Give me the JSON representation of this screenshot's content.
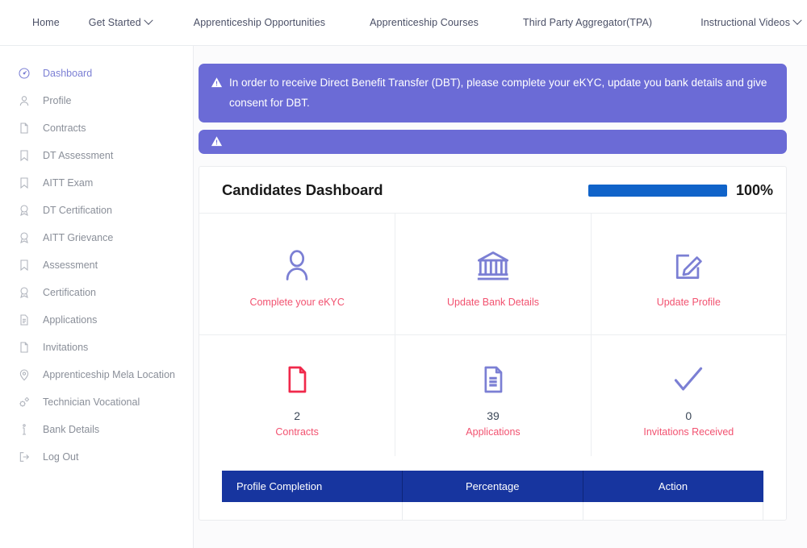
{
  "topnav": {
    "items": [
      {
        "label": "Home",
        "has_chevron": false
      },
      {
        "label": "Get Started",
        "has_chevron": true
      },
      {
        "label": "Apprenticeship Opportunities",
        "has_chevron": false
      },
      {
        "label": "Apprenticeship Courses",
        "has_chevron": false
      },
      {
        "label": "Third Party Aggregator(TPA)",
        "has_chevron": false
      },
      {
        "label": "Instructional Videos",
        "has_chevron": true
      }
    ]
  },
  "sidebar": {
    "items": [
      {
        "label": "Dashboard",
        "icon": "dashboard-gauge-icon",
        "active": true
      },
      {
        "label": "Profile",
        "icon": "user-icon",
        "active": false
      },
      {
        "label": "Contracts",
        "icon": "document-icon",
        "active": false
      },
      {
        "label": "DT Assessment",
        "icon": "bookmark-icon",
        "active": false
      },
      {
        "label": "AITT Exam",
        "icon": "bookmark-icon",
        "active": false
      },
      {
        "label": "DT Certification",
        "icon": "award-icon",
        "active": false
      },
      {
        "label": "AITT Grievance",
        "icon": "award-icon",
        "active": false
      },
      {
        "label": "Assessment",
        "icon": "bookmark-icon",
        "active": false
      },
      {
        "label": "Certification",
        "icon": "award-icon",
        "active": false
      },
      {
        "label": "Applications",
        "icon": "file-lines-icon",
        "active": false
      },
      {
        "label": "Invitations",
        "icon": "document-icon",
        "active": false
      },
      {
        "label": "Apprenticeship Mela Location",
        "icon": "map-pin-icon",
        "active": false
      },
      {
        "label": "Technician Vocational",
        "icon": "gears-icon",
        "active": false
      },
      {
        "label": "Bank Details",
        "icon": "info-icon",
        "active": false
      },
      {
        "label": "Log Out",
        "icon": "logout-icon",
        "active": false
      }
    ]
  },
  "alerts": [
    {
      "icon": "warning-triangle-icon",
      "text": "In order to receive Direct Benefit Transfer (DBT), please complete your eKYC, update you bank details and give consent for DBT."
    },
    {
      "icon": "warning-triangle-icon",
      "text": ""
    }
  ],
  "dashboard": {
    "title": "Candidates Dashboard",
    "progress_percent_label": "100%",
    "progress_percent_value": 100,
    "tiles_row_1": [
      {
        "icon": "user-outline-icon",
        "count": "",
        "label": "Complete your eKYC"
      },
      {
        "icon": "bank-icon",
        "count": "",
        "label": "Update Bank Details"
      },
      {
        "icon": "edit-document-icon",
        "count": "",
        "label": "Update Profile"
      }
    ],
    "tiles_row_2": [
      {
        "icon": "document-red-icon",
        "count": "2",
        "label": "Contracts"
      },
      {
        "icon": "file-lines-icon",
        "count": "39",
        "label": "Applications"
      },
      {
        "icon": "check-icon",
        "count": "0",
        "label": "Invitations Received"
      }
    ],
    "table": {
      "columns": [
        "Profile Completion",
        "Percentage",
        "Action"
      ]
    }
  },
  "colors": {
    "alert_purple": "#6b6bd6",
    "accent_indigo": "#7b7fd4",
    "link_pink": "#f25270",
    "progress_blue": "#1063c9",
    "table_header_blue": "#17359f",
    "icon_red": "#f0294b"
  }
}
